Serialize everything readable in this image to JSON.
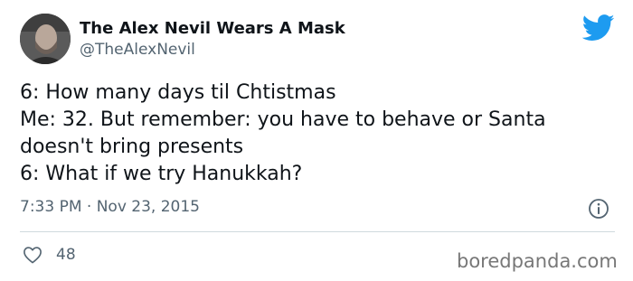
{
  "user": {
    "display_name": "The Alex Nevil Wears A Mask",
    "handle": "@TheAlexNevil",
    "avatar_icon": "profile-photo"
  },
  "tweet": {
    "lines": [
      "6: How many days til Chtistmas",
      "Me: 32. But remember: you have to behave or Santa",
      "doesn't bring presents",
      "6: What if we try Hanukkah?"
    ],
    "timestamp": "7:33 PM · Nov 23, 2015"
  },
  "actions": {
    "like_count": "48",
    "like_icon": "heart-icon",
    "info_icon": "info-icon"
  },
  "branding": {
    "platform_icon": "twitter-bird-icon",
    "watermark": "boredpanda.com"
  },
  "colors": {
    "text": "#0f1419",
    "secondary": "#536471",
    "brand_blue": "#1d9bf0",
    "divider": "#cfd9de"
  }
}
